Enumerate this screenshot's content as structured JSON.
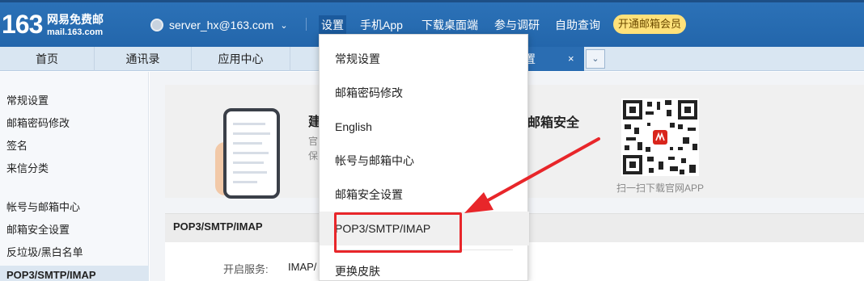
{
  "header": {
    "logo_number": "163",
    "logo_title": "网易免费邮",
    "logo_domain": "mail.163.com",
    "account": "server_hx@163.com",
    "nav": [
      "设置",
      "手机App",
      "下载桌面端",
      "参与调研",
      "自助查询"
    ],
    "vip_button": "开通邮箱会员"
  },
  "tabs": {
    "items": [
      "首页",
      "通讯录",
      "应用中心"
    ],
    "active_label_visible": "置",
    "close": "×",
    "more": "⌄"
  },
  "sidebar": {
    "items": [
      "常规设置",
      "邮箱密码修改",
      "签名",
      "来信分类",
      "帐号与邮箱中心",
      "邮箱安全设置",
      "反垃圾/黑白名单",
      "POP3/SMTP/IMAP"
    ],
    "active_index": 7
  },
  "banner": {
    "title_visible": "建",
    "sub1_visible": "官",
    "sub2_visible": "保",
    "right_title_visible": "邮箱安全",
    "right_sub1_visible": "",
    "right_sub2_visible": "",
    "qr_caption": "扫一扫下载官网APP"
  },
  "section": {
    "title": "POP3/SMTP/IMAP",
    "service_label": "开启服务:",
    "service_value": "IMAP/"
  },
  "menu": {
    "items": [
      "常规设置",
      "邮箱密码修改",
      "English",
      "帐号与邮箱中心",
      "邮箱安全设置",
      "POP3/SMTP/IMAP",
      "更换皮肤"
    ],
    "highlighted_index": 5
  },
  "colors": {
    "header_blue": "#2366ab",
    "vip_yellow": "#ffe17a",
    "annotation_red": "#e8262a"
  }
}
